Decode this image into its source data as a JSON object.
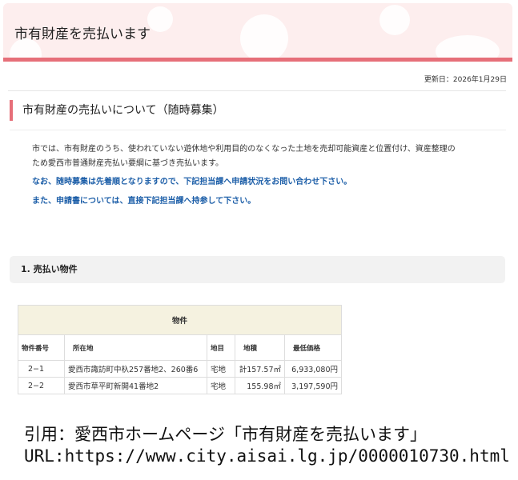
{
  "header": {
    "title": "市有財産を売払います"
  },
  "updated": "更新日：2026年1月29日",
  "section_title": "市有財産の売払いについて（随時募集）",
  "paragraphs": [
    "市では、市有財産のうち、使われていない遊休地や利用目的のなくなった土地を売却可能資産と位置付け、資産整理の",
    "ため愛西市普通財産売払い要綱に基づき売払います。"
  ],
  "notes": [
    "なお、随時募集は先着順となりますので、下記担当課へ申請状況をお問い合わせ下さい。",
    "また、申請書については、直接下記担当課へ持参して下さい。"
  ],
  "subsection_title": "1.  売払い物件",
  "table": {
    "caption": "物件",
    "headers": [
      "物件番号",
      "所在地",
      "地目",
      "地積",
      "最低価格"
    ],
    "rows": [
      [
        "2−1",
        "愛西市諏訪町中杁257番地2、260番6",
        "宅地",
        "計157.57㎡",
        "6,933,080円"
      ],
      [
        "2−2",
        "愛西市草平町新開41番地2",
        "宅地",
        "155.98㎡",
        "3,197,590円"
      ]
    ]
  },
  "citation": {
    "line1": "引用：愛西市ホームページ「市有財産を売払います」",
    "line2": "URL:https://www.city.aisai.lg.jp/0000010730.html"
  },
  "colors": {
    "accent": "#e66f79",
    "header_bg": "#fdeeee",
    "link_blue": "#1c5ea8"
  }
}
